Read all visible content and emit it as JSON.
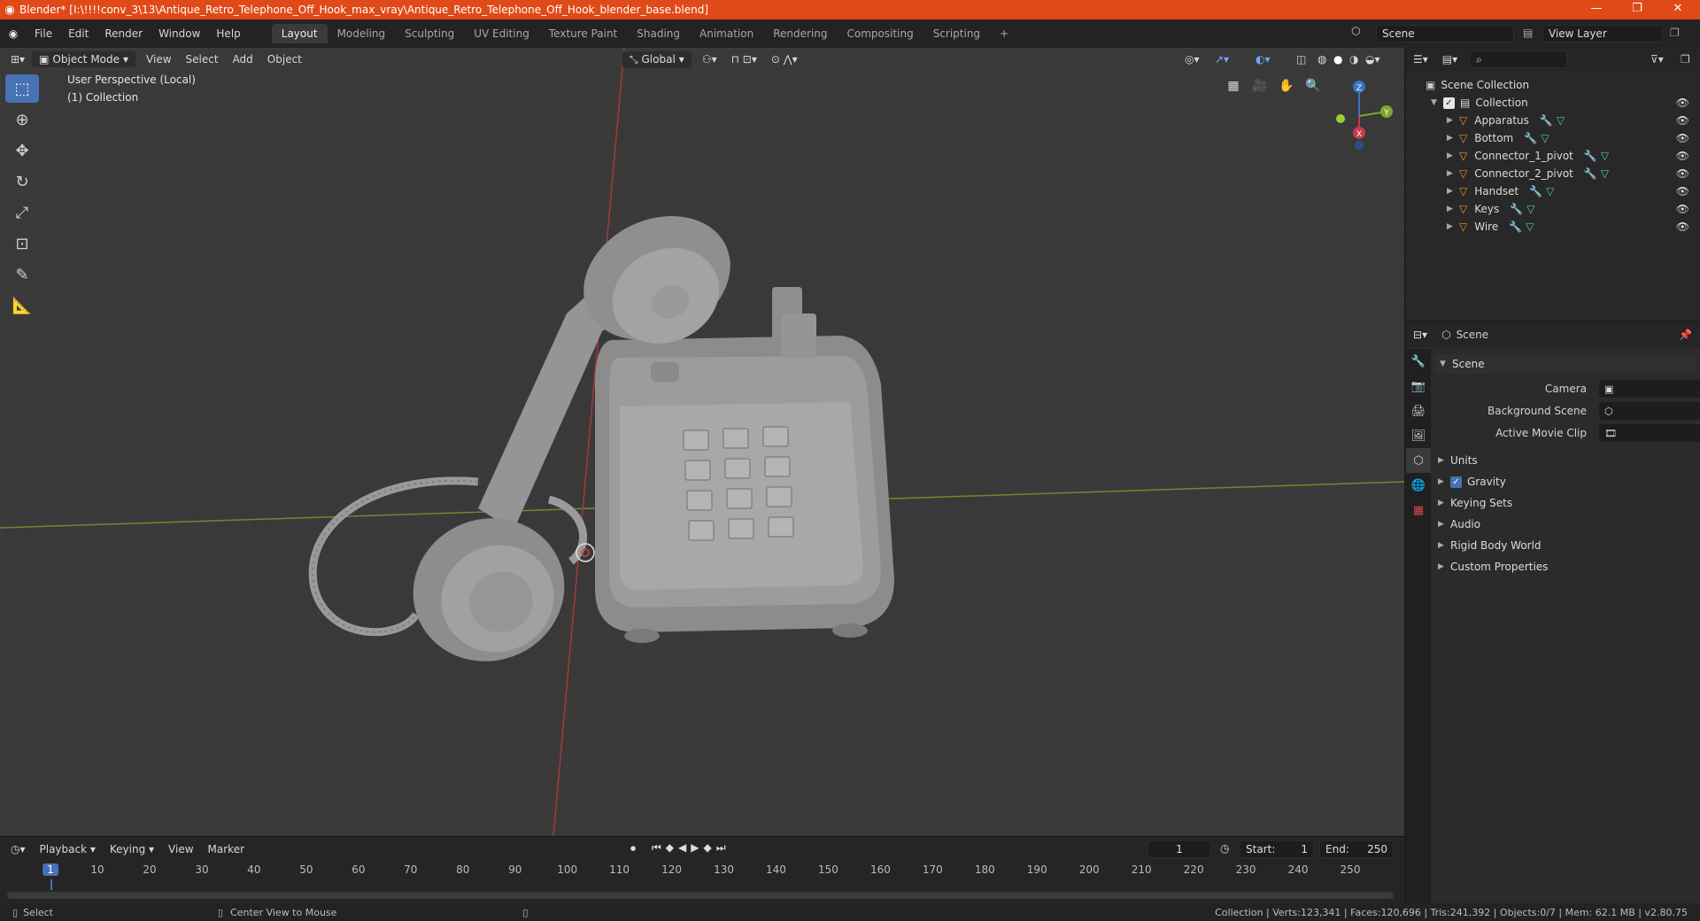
{
  "window": {
    "title": "Blender* [I:\\!!!!conv_3\\13\\Antique_Retro_Telephone_Off_Hook_max_vray\\Antique_Retro_Telephone_Off_Hook_blender_base.blend]",
    "minimize": "—",
    "maximize": "❐",
    "close": "✕"
  },
  "menu": {
    "items": [
      "File",
      "Edit",
      "Render",
      "Window",
      "Help"
    ],
    "workspaces": [
      "Layout",
      "Modeling",
      "Sculpting",
      "UV Editing",
      "Texture Paint",
      "Shading",
      "Animation",
      "Rendering",
      "Compositing",
      "Scripting"
    ],
    "active_workspace": "Layout",
    "add_workspace": "+",
    "scene_label": "Scene",
    "view_layer_label": "View Layer"
  },
  "viewport": {
    "mode": "Object Mode",
    "menus": [
      "View",
      "Select",
      "Add",
      "Object"
    ],
    "orientation": "Global",
    "info_line1": "User Perspective (Local)",
    "info_line2": "(1) Collection",
    "gizmo": {
      "z": "Z",
      "y": "Y",
      "x": "X"
    },
    "background_color": "#393939"
  },
  "timeline": {
    "menus": [
      "Playback",
      "Keying",
      "View",
      "Marker"
    ],
    "current_frame": "1",
    "start_label": "Start:",
    "start": "1",
    "end_label": "End:",
    "end": "250",
    "ticks": [
      "1",
      "10",
      "20",
      "30",
      "40",
      "50",
      "60",
      "70",
      "80",
      "90",
      "100",
      "110",
      "120",
      "130",
      "140",
      "150",
      "160",
      "170",
      "180",
      "190",
      "200",
      "210",
      "220",
      "230",
      "240",
      "250"
    ]
  },
  "status": {
    "select": "Select",
    "center": "Center View to Mouse",
    "stats": "Collection | Verts:123,341 | Faces:120,696 | Tris:241,392 | Objects:0/7 | Mem: 62.1 MB | v2.80.75"
  },
  "outliner": {
    "scene_collection": "Scene Collection",
    "collection": "Collection",
    "objects": [
      "Apparatus",
      "Bottom",
      "Connector_1_pivot",
      "Connector_2_pivot",
      "Handset",
      "Keys",
      "Wire"
    ]
  },
  "properties": {
    "header": "Scene",
    "panel": "Scene",
    "camera_label": "Camera",
    "background_scene_label": "Background Scene",
    "active_movie_clip_label": "Active Movie Clip",
    "sections": [
      "Units",
      "Gravity",
      "Keying Sets",
      "Audio",
      "Rigid Body World",
      "Custom Properties"
    ]
  },
  "colors": {
    "titlebar": "#e04a18",
    "accent": "#4772b3",
    "object_icon": "#e8913a",
    "modifier_icon": "#6fa8ff",
    "mesh_icon": "#3fd6a6"
  }
}
